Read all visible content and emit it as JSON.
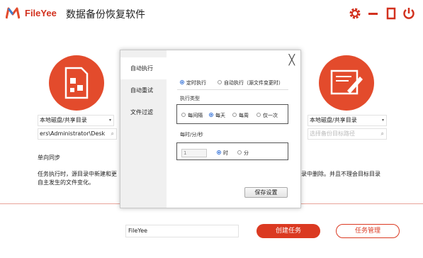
{
  "app": {
    "brand": "FileYee",
    "title": "数据备份恢复软件"
  },
  "colors": {
    "accent": "#db3a22",
    "circle": "#e34b2c",
    "selection": "#2f6fd8"
  },
  "source": {
    "location": "本地磁盘/共享目录",
    "path": "ers\\Administrator\\Desk"
  },
  "target": {
    "location": "本地磁盘/共享目录",
    "path_placeholder": "选择备份目标路径"
  },
  "mode": {
    "name": "单向同步",
    "description_line1": "任务执行时，源目录中新建和更",
    "description_line2": "自主发生的文件变化。",
    "description_right": "录中删除。并且不理会目标目录"
  },
  "footer": {
    "task_name": "FileYee",
    "create_label": "创建任务",
    "manage_label": "任务管理"
  },
  "dialog": {
    "tabs": [
      "自动执行",
      "自动重试",
      "文件过滤"
    ],
    "close": "╳",
    "trigger": {
      "scheduled": "定时执行",
      "on_change": "自动执行（源文件变更时）"
    },
    "exec_type_label": "执行类型",
    "exec_types": [
      "每间隔",
      "每天",
      "每周",
      "仅一次"
    ],
    "time_label": "每时/分/秒",
    "interval_value": "1",
    "units": [
      "时",
      "分"
    ],
    "save_label": "保存设置"
  }
}
